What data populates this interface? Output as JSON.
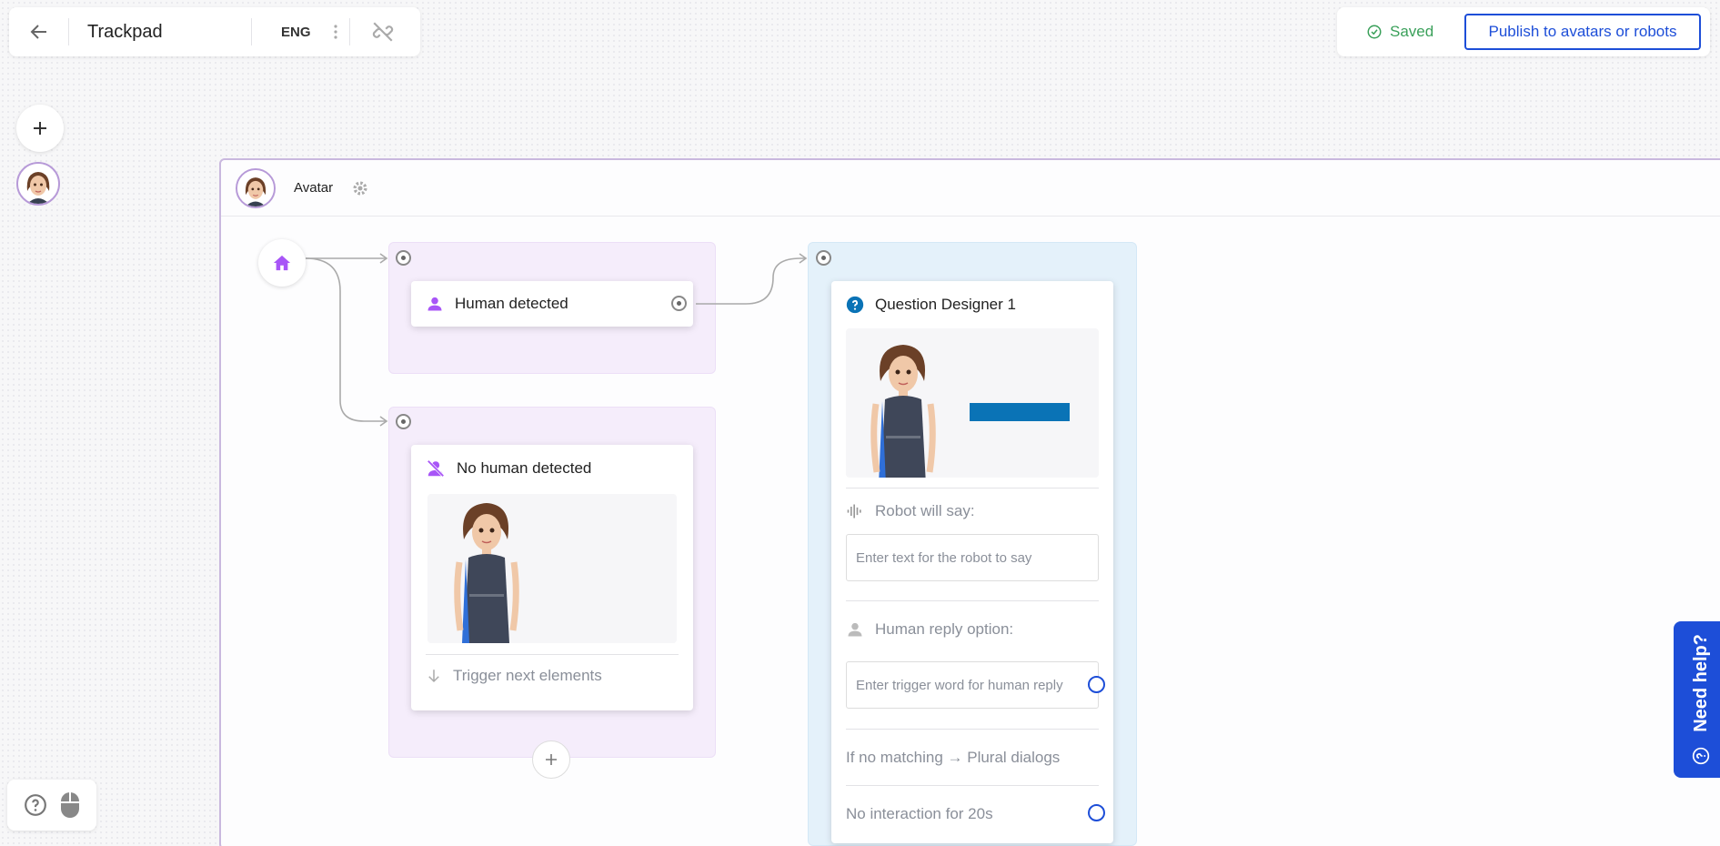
{
  "header": {
    "title": "Trackpad",
    "language": "ENG",
    "saved_label": "Saved",
    "publish_label": "Publish to avatars or robots"
  },
  "canvas": {
    "avatar_label": "Avatar"
  },
  "nodes": {
    "human_detected": {
      "title": "Human detected"
    },
    "no_human_detected": {
      "title": "No human detected",
      "trigger_label": "Trigger next elements"
    },
    "question": {
      "title": "Question Designer 1",
      "robot_say_label": "Robot will say:",
      "robot_say_placeholder": "Enter text for the robot to say",
      "human_reply_label": "Human reply option:",
      "human_reply_placeholder": "Enter trigger word for human reply",
      "no_match_label": "If no matching → Plural dialogs",
      "no_interaction_label": "No interaction for 20s"
    }
  },
  "help": {
    "need_help_label": "Need help?"
  },
  "colors": {
    "accent": "#1d4ed8",
    "saved_green": "#3aa05a",
    "purple_icon": "#a855f7",
    "question_blue": "#0a73b6",
    "lane_purple": "#f5edfb",
    "lane_blue": "#e4f1fa"
  },
  "icons": {
    "back": "arrow-left-icon",
    "more": "kebab-icon",
    "unlink": "unlink-icon",
    "saved": "check-circle-icon",
    "home": "home-icon",
    "person": "person-icon",
    "no_person": "person-off-icon",
    "question": "question-circle-icon",
    "voice": "voice-wave-icon",
    "arrow_down": "arrow-down-icon",
    "settings": "gear-icon"
  }
}
